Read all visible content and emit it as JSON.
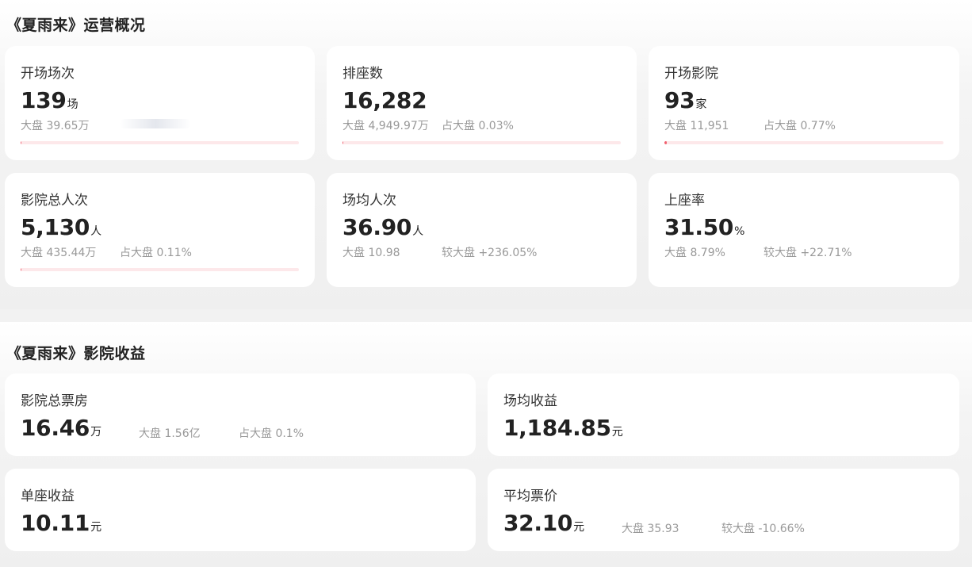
{
  "section1": {
    "title": "《夏雨来》运营概况",
    "cards": [
      {
        "label": "开场场次",
        "value": "139",
        "unit": "场",
        "market": "大盘 39.65万",
        "share": "",
        "progress": 0.0035
      },
      {
        "label": "排座数",
        "value": "16,282",
        "unit": "",
        "market": "大盘 4,949.97万",
        "share": "占大盘 0.03%",
        "progress": 0.0003
      },
      {
        "label": "开场影院",
        "value": "93",
        "unit": "家",
        "market": "大盘 11,951",
        "share": "占大盘 0.77%",
        "progress": 0.0077
      },
      {
        "label": "影院总人次",
        "value": "5,130",
        "unit": "人",
        "market": "大盘 435.44万",
        "share": "占大盘 0.11%",
        "progress": 0.0011
      },
      {
        "label": "场均人次",
        "value": "36.90",
        "unit": "人",
        "market": "大盘 10.98",
        "share": "较大盘 +236.05%"
      },
      {
        "label": "上座率",
        "value": "31.50",
        "unit": "%",
        "market": "大盘 8.79%",
        "share": "较大盘 +22.71%"
      }
    ]
  },
  "section2": {
    "title": "《夏雨来》影院收益",
    "cards": [
      {
        "label": "影院总票房",
        "value": "16.46",
        "unit": "万",
        "market": "大盘 1.56亿",
        "share": "占大盘 0.1%"
      },
      {
        "label": "场均收益",
        "value": "1,184.85",
        "unit": "元",
        "market": "",
        "share": ""
      },
      {
        "label": "单座收益",
        "value": "10.11",
        "unit": "元",
        "market": "",
        "share": ""
      },
      {
        "label": "平均票价",
        "value": "32.10",
        "unit": "元",
        "market": "大盘 35.93",
        "share": "较大盘 -10.66%"
      }
    ]
  },
  "colors": {
    "accent": "#f0616f",
    "bar_track": "#fde8ea",
    "muted_text": "#999999"
  }
}
